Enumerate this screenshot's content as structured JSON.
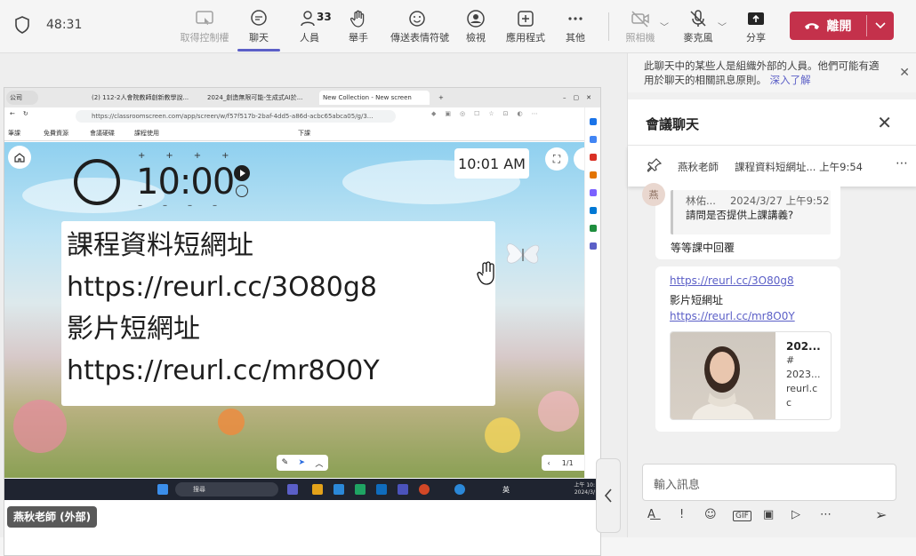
{
  "meeting": {
    "timer": "48:31"
  },
  "toolbar": {
    "take_control": "取得控制權",
    "chat": "聊天",
    "people": "人員",
    "people_count": "33",
    "raise_hand": "舉手",
    "reactions": "傳送表情符號",
    "view": "檢視",
    "apps": "應用程式",
    "more": "其他",
    "camera": "照相機",
    "mic": "麥克風",
    "share": "分享",
    "leave": "離開"
  },
  "browser": {
    "tabs": [
      "公司",
      "(2) 112-2人會院教師創新教學說...",
      "2024_創造無限可能-生成式AI於...",
      "New Collection - New screen"
    ],
    "url": "https://classroomscreen.com/app/screen/w/f57f517b-2baf-4dd5-a86d-acbc65abca05/g/3...",
    "bookmarks": [
      "筆課",
      "免費資源",
      "會議硬碟",
      "課程使用",
      "下課"
    ]
  },
  "classroom": {
    "timer": "10:00",
    "clock": "10:01 AM",
    "text_lines": [
      "課程資料短網址",
      "https://reurl.cc/3O80g8",
      "影片短網址",
      "https://reurl.cc/mr8O0Y"
    ],
    "page": "1/1"
  },
  "taskbar": {
    "search_placeholder": "搜尋",
    "lang": "英",
    "time": "上午 10:",
    "date": "2024/3/"
  },
  "presenter": {
    "name": "燕秋老師 (外部)"
  },
  "chat": {
    "notice": "此聊天中的某些人是組織外部的人員。他們可能有適用於聊天的相關訊息原則。",
    "notice_link": "深入了解",
    "title": "會議聊天",
    "pinned": {
      "author": "燕秋老師",
      "text": "課程資料短網址...",
      "time": "上午9:54"
    },
    "avatar_initial": "燕",
    "reply": {
      "quote_author": "林佑...",
      "quote_time": "2024/3/27 上午9:52",
      "quote_text": "請問是否提供上課講義?",
      "text": "等等課中回覆"
    },
    "links_message": {
      "link1": "https://reurl.cc/3O80g8",
      "label": "影片短網址",
      "link2": "https://reurl.cc/mr8O0Y",
      "card_title": "202...",
      "card_line2": "#",
      "card_line3": "2023...",
      "card_domain": "reurl.c",
      "card_domain2": "c"
    },
    "compose_placeholder": "輸入訊息"
  }
}
